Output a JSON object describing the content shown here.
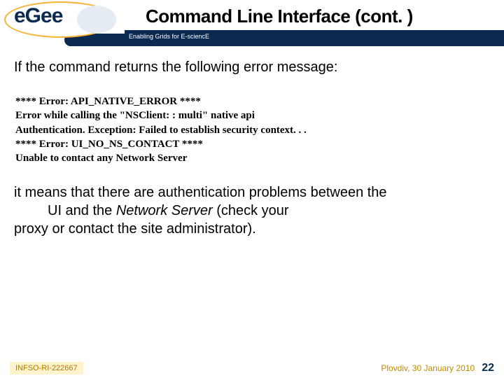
{
  "header": {
    "logo_text": "eGee",
    "title": "Command Line Interface (cont. )",
    "subtitle": "Enabling Grids for E-sciencE"
  },
  "body": {
    "intro": "If the command returns the following error message:",
    "error_lines": [
      "**** Error: API_NATIVE_ERROR ****",
      "Error while calling the \"NSClient: : multi\" native api",
      "Authentication. Exception: Failed to establish security context. . .",
      "**** Error: UI_NO_NS_CONTACT ****",
      "Unable to contact any Network Server"
    ],
    "explain_line1_pre": "it means that there are authentication problems between the",
    "explain_line2_pre": "UI and the ",
    "explain_line2_em": "Network Server",
    "explain_line2_post": " (check your",
    "explain_line3": "proxy or contact the site administrator)."
  },
  "footer": {
    "left": "INFSO-RI-222667",
    "location": "Plovdiv, 30 January 2010",
    "page": "22"
  },
  "colors": {
    "brand_dark": "#0a2a52",
    "brand_accent": "#f9b233"
  }
}
